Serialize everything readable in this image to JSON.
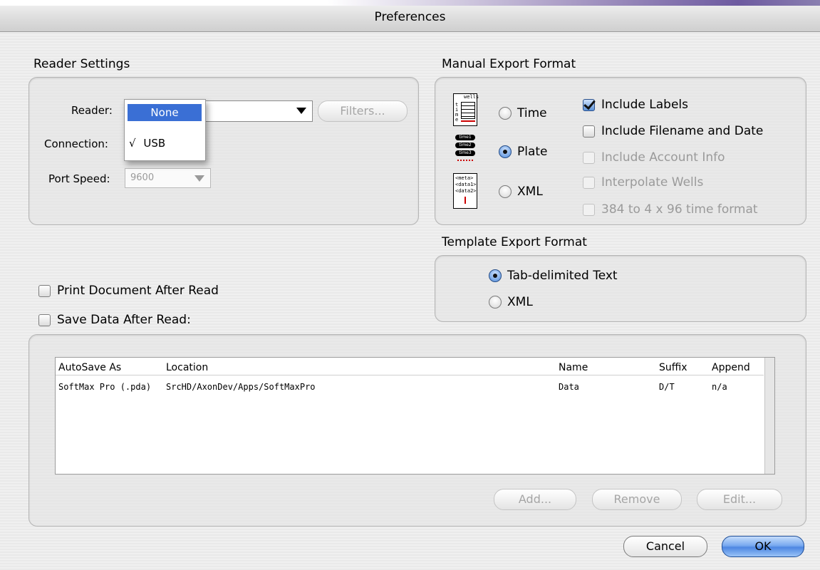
{
  "window": {
    "title": "Preferences"
  },
  "reader_settings": {
    "heading": "Reader Settings",
    "reader_label": "Reader:",
    "connection_label": "Connection:",
    "port_speed_label": "Port Speed:",
    "port_speed_value": "9600",
    "filters_button": "Filters...",
    "reader_menu": {
      "highlighted_item": "None",
      "checked_item": "USB",
      "check_mark": "√"
    }
  },
  "manual_export": {
    "heading": "Manual Export Format",
    "options": [
      {
        "label": "Time",
        "selected": false
      },
      {
        "label": "Plate",
        "selected": true
      },
      {
        "label": "XML",
        "selected": false
      }
    ],
    "icons": {
      "time": {
        "top": "wells",
        "side": "time"
      },
      "plate": {
        "rows": [
          "time1",
          "time2",
          "time3"
        ]
      },
      "xml": {
        "lines": [
          "<meta>",
          "<data1>",
          "<data2>"
        ]
      }
    },
    "checkboxes": [
      {
        "label": "Include Labels",
        "checked": true,
        "enabled": true
      },
      {
        "label": "Include Filename and Date",
        "checked": false,
        "enabled": true
      },
      {
        "label": "Include Account Info",
        "checked": false,
        "enabled": false
      },
      {
        "label": "Interpolate Wells",
        "checked": false,
        "enabled": false
      },
      {
        "label": "384 to 4 x 96 time format",
        "checked": false,
        "enabled": false
      }
    ]
  },
  "template_export": {
    "heading": "Template Export Format",
    "options": [
      {
        "label": "Tab-delimited Text",
        "selected": true
      },
      {
        "label": "XML",
        "selected": false
      }
    ]
  },
  "print_after_read": {
    "label": "Print Document After Read",
    "checked": false
  },
  "save_after_read": {
    "label": "Save Data After Read:",
    "checked": false
  },
  "autosave_table": {
    "columns": [
      "AutoSave As",
      "Location",
      "Name",
      "Suffix",
      "Append"
    ],
    "rows": [
      [
        "SoftMax Pro (.pda)",
        "SrcHD/AxonDev/Apps/SoftMaxPro",
        "Data",
        "D/T",
        "n/a"
      ]
    ]
  },
  "table_buttons": {
    "add": "Add...",
    "remove": "Remove",
    "edit": "Edit..."
  },
  "footer": {
    "cancel": "Cancel",
    "ok": "OK"
  },
  "colors": {
    "accent": "#3a6fd5",
    "default_button": "#4d87e2"
  }
}
